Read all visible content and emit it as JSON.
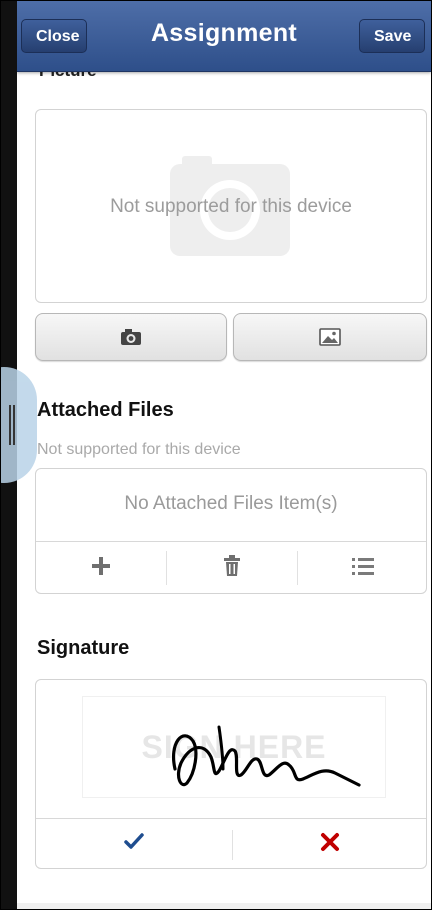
{
  "header": {
    "title": "Assignment",
    "close_label": "Close",
    "save_label": "Save"
  },
  "sections": {
    "picture": {
      "label": "Picture",
      "placeholder_text": "Not supported for this device",
      "buttons": [
        "camera-icon",
        "image-icon"
      ]
    },
    "attached_files": {
      "title": "Attached Files",
      "note": "Not supported for this device",
      "empty_text": "No Attached Files Item(s)",
      "actions": [
        "plus-icon",
        "trash-icon",
        "list-icon"
      ]
    },
    "signature": {
      "title": "Signature",
      "sign_here_text": "SIGN HERE",
      "actions": [
        "checkmark-icon",
        "x-icon"
      ]
    }
  },
  "colors": {
    "header_top": "#4e6ea8",
    "header_bottom": "#2e4f8a",
    "confirm": "#1f4d8f",
    "delete": "#c00000",
    "handle": "#b9d3e8"
  }
}
